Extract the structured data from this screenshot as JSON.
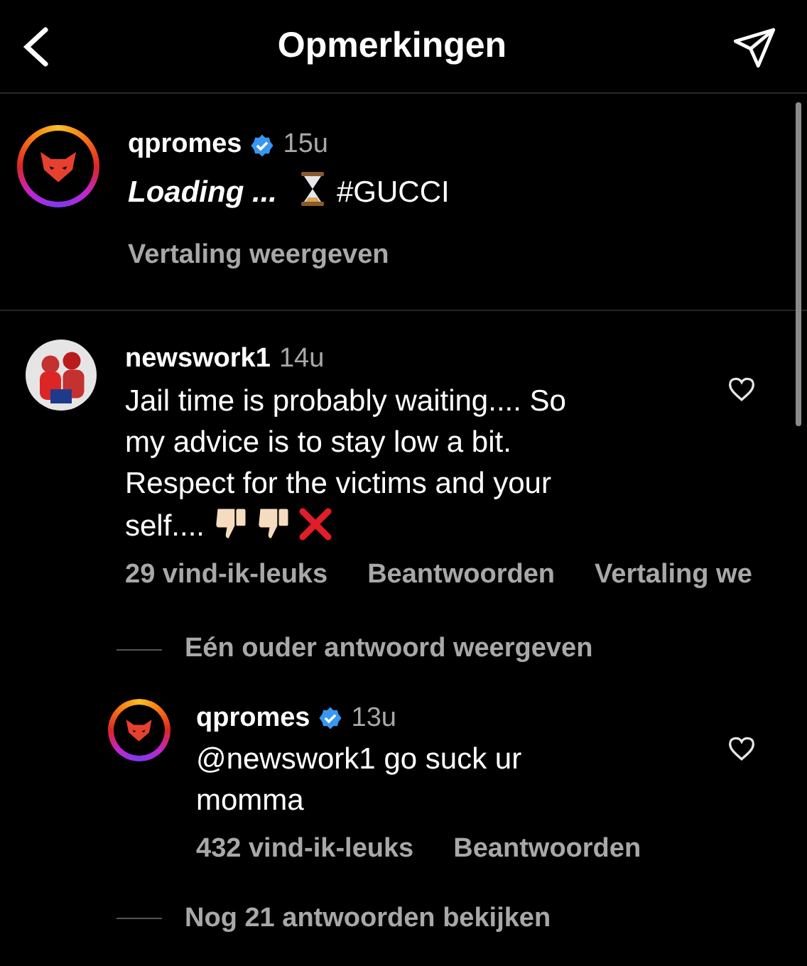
{
  "header": {
    "title": "Opmerkingen"
  },
  "caption": {
    "username": "qpromes",
    "verified": true,
    "time": "15u",
    "avatar": {
      "kind": "logo",
      "ring": true
    },
    "segments": [
      {
        "kind": "emphasis",
        "text": "Loading ..."
      },
      {
        "kind": "hourglass"
      },
      {
        "kind": "text",
        "text": "#GUCCI"
      }
    ],
    "translate": "Vertaling weergeven"
  },
  "comments": [
    {
      "username": "newswork1",
      "verified": false,
      "time": "14u",
      "avatar": {
        "kind": "picture",
        "ring": false
      },
      "segments": [
        {
          "kind": "text",
          "text": "Jail time is probably waiting.... So my advice is to stay low a bit. Respect for the victims and your"
        },
        {
          "kind": "text",
          "text": "self...."
        },
        {
          "kind": "thumbs-down"
        },
        {
          "kind": "thumbs-down"
        },
        {
          "kind": "cross"
        }
      ],
      "actions": [
        "29 vind-ik-leuks",
        "Beantwoorden",
        "Vertaling we"
      ],
      "replies_toggle": "Eén ouder antwoord weergeven",
      "replies": [
        {
          "username": "qpromes",
          "verified": true,
          "time": "13u",
          "avatar": {
            "kind": "logo",
            "ring": true
          },
          "segments": [
            {
              "kind": "text",
              "text": "@newswork1 go suck ur momma"
            }
          ],
          "actions": [
            "432 vind-ik-leuks",
            "Beantwoorden"
          ]
        }
      ],
      "more_replies": "Nog 21 antwoorden bekijken"
    }
  ]
}
